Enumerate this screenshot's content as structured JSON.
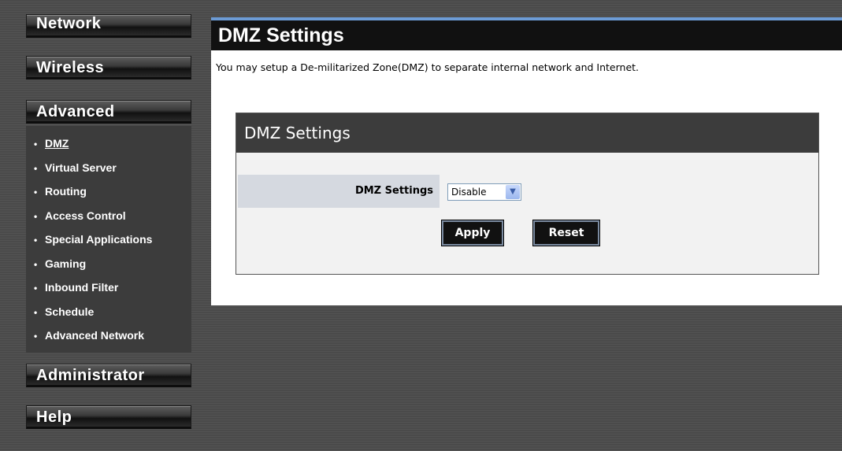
{
  "sidebar": {
    "network": "Network",
    "wireless": "Wireless",
    "advanced": "Advanced",
    "administrator": "Administrator",
    "help": "Help",
    "advanced_items": [
      {
        "label": "DMZ",
        "active": true
      },
      {
        "label": "Virtual Server"
      },
      {
        "label": "Routing"
      },
      {
        "label": "Access Control"
      },
      {
        "label": "Special Applications"
      },
      {
        "label": "Gaming"
      },
      {
        "label": "Inbound Filter"
      },
      {
        "label": "Schedule"
      },
      {
        "label": "Advanced Network"
      }
    ],
    "bullet": "•"
  },
  "main": {
    "title": "DMZ Settings",
    "intro": "You may setup a De-militarized Zone(DMZ) to separate internal network and Internet.",
    "box_title": "DMZ Settings",
    "field_label": "DMZ Settings",
    "field_value": "Disable",
    "apply_label": "Apply",
    "reset_label": "Reset"
  },
  "colors": {
    "accent": "#6c9bd5",
    "header_bg": "#111111",
    "box_header_bg": "#3c3c3c",
    "label_bg": "#d5d9e0"
  }
}
